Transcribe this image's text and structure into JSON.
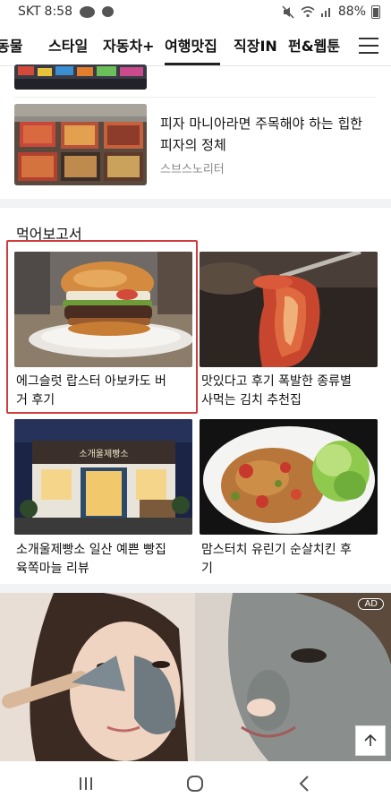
{
  "status_bar": {
    "carrier": "SKT",
    "time": "8:58",
    "chat_badge": "TALK",
    "battery": "88%"
  },
  "categories": [
    "동물",
    "스타일",
    "자동차+",
    "여행맛집",
    "직장IN",
    "펀&웹툰"
  ],
  "active_category": "여행맛집",
  "list_articles": [
    {
      "title_line1": "피자 마니아라면 주목해야 하는 힙한",
      "title_line2": "피자의 정체",
      "source": "스브스노리터"
    }
  ],
  "section": {
    "title": "먹어보고서",
    "cards": [
      {
        "title_line1": "에그슬럿 랍스터 아보카도 버",
        "title_line2": "거 후기"
      },
      {
        "title_line1": "맛있다고 후기 폭발한 종류별",
        "title_line2": "사먹는 김치 추천집"
      },
      {
        "title_line1": "소개울제빵소 일산 예쁜 빵집",
        "title_line2": "육쪽마늘 리뷰"
      },
      {
        "title_line1": "맘스터치 유린기 순살치킨 후",
        "title_line2": "기"
      }
    ],
    "bakery_sign": "소개울제빵소"
  },
  "ad": {
    "badge": "AD"
  },
  "colors": {
    "highlight": "#d23b3b",
    "active_underline": "#222222",
    "source_gray": "#888888"
  },
  "icons": {
    "status": [
      "talk-icon",
      "chat-bubble-icon",
      "mute-icon",
      "wifi-icon",
      "signal-icon",
      "battery-icon"
    ],
    "nav": [
      "recent-apps-icon",
      "home-icon",
      "back-icon"
    ],
    "menu": "hamburger-menu-icon",
    "scroll_top": "arrow-up-icon"
  }
}
